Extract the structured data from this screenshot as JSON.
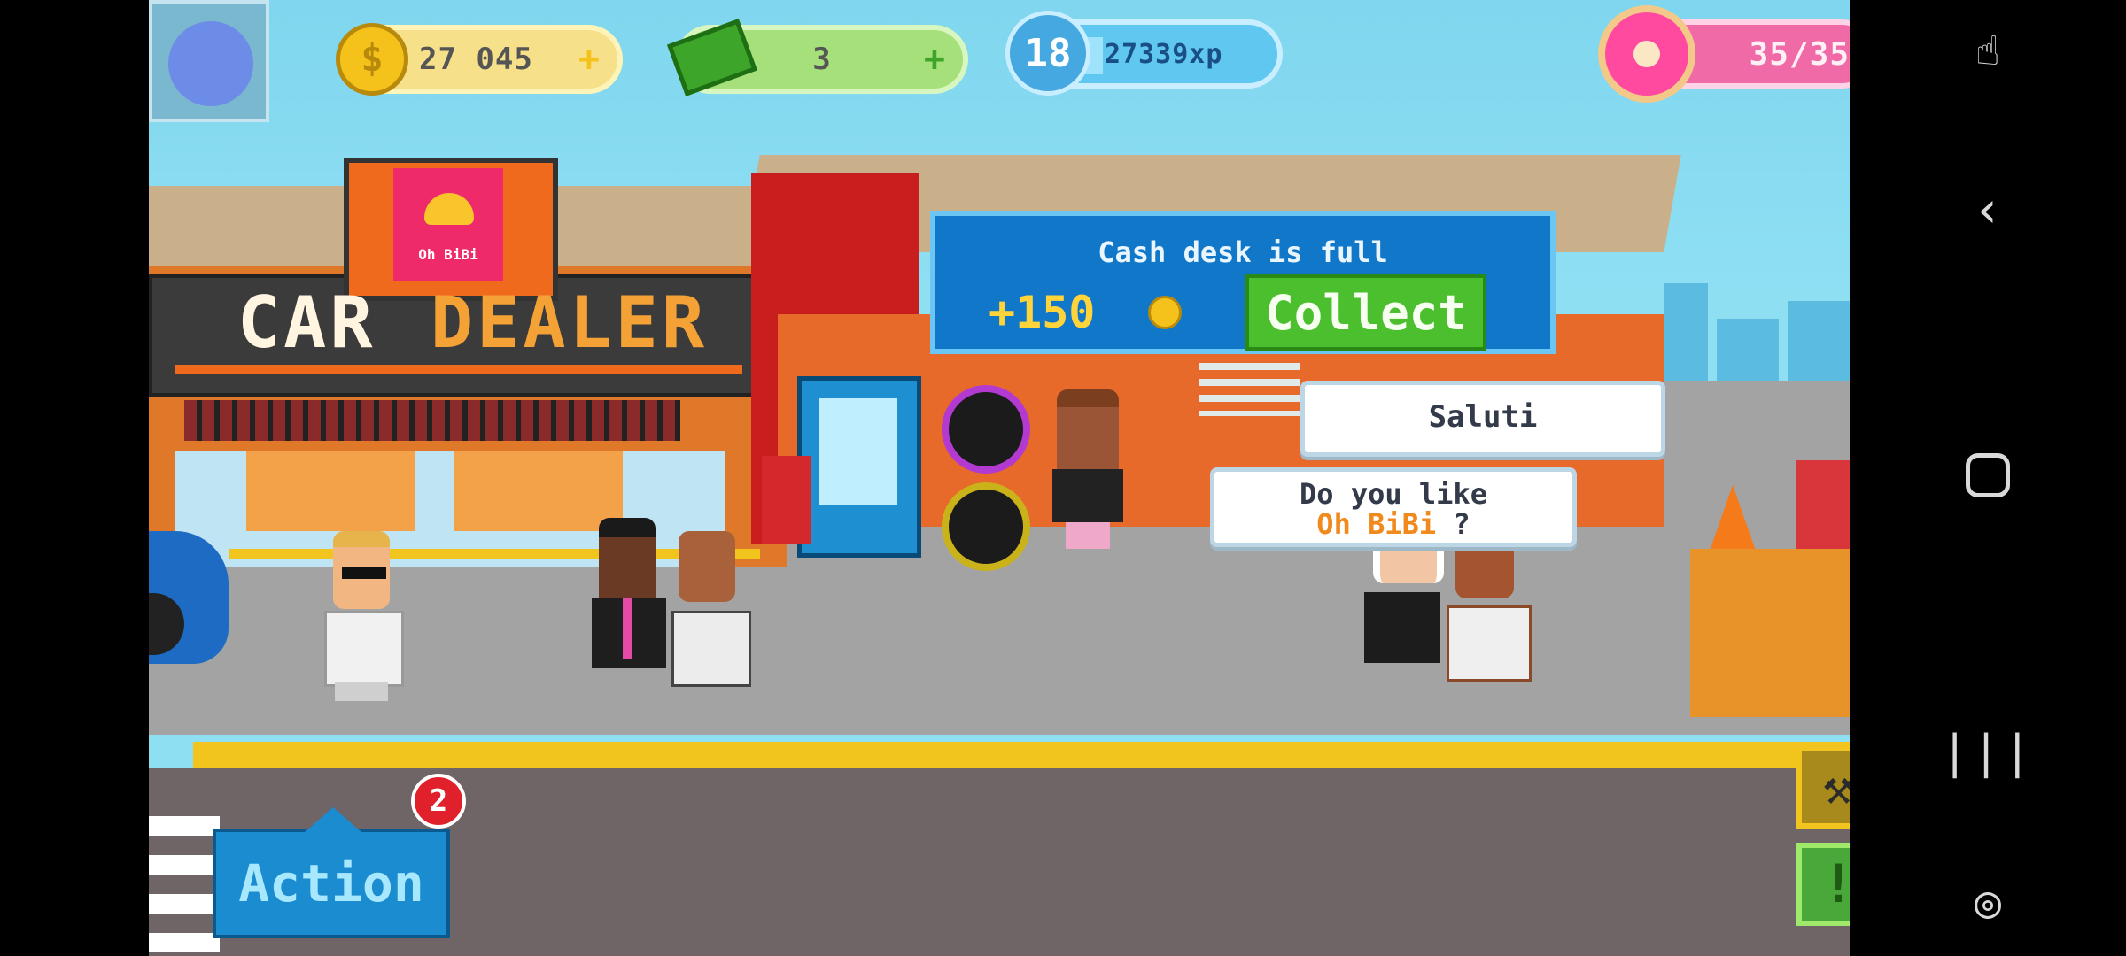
{
  "hud": {
    "coins": "27 045",
    "cash": "3",
    "level": "18",
    "xp": "27339xp",
    "donuts": "35/35",
    "xp_progress": 0.12
  },
  "building": {
    "sign_brand": "Oh BiBi",
    "sign_car": "CAR",
    "sign_dealer": "DEALER"
  },
  "cash_desk": {
    "title": "Cash desk is full",
    "amount": "+150",
    "collect_label": "Collect"
  },
  "bubbles": {
    "saluti": "Saluti",
    "question_line1": "Do you like",
    "question_brand": "Oh BiBi",
    "question_mark": "?"
  },
  "action": {
    "label": "Action",
    "badge": "2"
  },
  "colors": {
    "coin_pill": "#f7e08a",
    "cash_pill": "#a6e07a",
    "xp_pill": "#5fc7f0",
    "donut_pill": "#f06aa8",
    "collect_green": "#4cbf2e",
    "dealer_orange": "#f4a235",
    "road": "#6f6466",
    "sidewalk": "#9b9b9b"
  },
  "icons": {
    "avatar": "splat-avatar-icon",
    "coin": "coin-icon",
    "cash": "banknote-icon",
    "level": "star-level-icon",
    "donut": "donut-icon",
    "wrench": "wrench-icon",
    "alert": "exclamation-icon",
    "nav_touch": "touch-icon",
    "nav_back": "back-icon",
    "nav_home": "home-icon",
    "nav_recents": "recents-icon",
    "nav_gamepad": "gamepad-icon"
  }
}
